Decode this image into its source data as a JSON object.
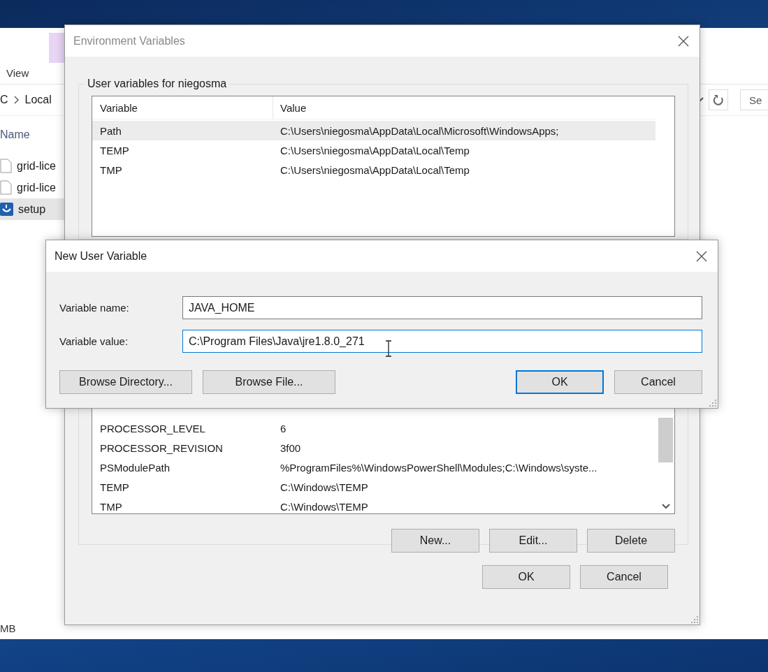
{
  "explorer": {
    "ribbon_tab": "View",
    "breadcrumb": [
      "C",
      "Local"
    ],
    "search": {
      "placeholder": "Se"
    },
    "column_header": "Name",
    "files": [
      {
        "name": "grid-lice",
        "kind": "file",
        "selected": false
      },
      {
        "name": "grid-lice",
        "kind": "file",
        "selected": false
      },
      {
        "name": "setup",
        "kind": "setup",
        "selected": true
      }
    ],
    "status_bar": "MB"
  },
  "environment_dialog": {
    "title": "Environment Variables",
    "user_group": "User variables for niegosma",
    "columns": [
      "Variable",
      "Value"
    ],
    "user_rows": [
      {
        "variable": "Path",
        "value": "C:\\Users\\niegosma\\AppData\\Local\\Microsoft\\WindowsApps;",
        "selected": true
      },
      {
        "variable": "TEMP",
        "value": "C:\\Users\\niegosma\\AppData\\Local\\Temp",
        "selected": false
      },
      {
        "variable": "TMP",
        "value": "C:\\Users\\niegosma\\AppData\\Local\\Temp",
        "selected": false
      }
    ],
    "system_rows": [
      {
        "variable": "PROCESSOR_LEVEL",
        "value": "6",
        "selected": false
      },
      {
        "variable": "PROCESSOR_REVISION",
        "value": "3f00",
        "selected": false
      },
      {
        "variable": "PSModulePath",
        "value": "%ProgramFiles%\\WindowsPowerShell\\Modules;C:\\Windows\\syste...",
        "selected": false
      },
      {
        "variable": "TEMP",
        "value": "C:\\Windows\\TEMP",
        "selected": false
      },
      {
        "variable": "TMP",
        "value": "C:\\Windows\\TEMP",
        "selected": false
      }
    ],
    "system_buttons": [
      "New...",
      "Edit...",
      "Delete"
    ],
    "buttons": [
      {
        "label": "OK",
        "default": false
      },
      {
        "label": "Cancel",
        "default": false
      }
    ]
  },
  "new_variable_dialog": {
    "title": "New User Variable",
    "fields": [
      {
        "label": "Variable name:",
        "value": "JAVA_HOME",
        "focused": false
      },
      {
        "label": "Variable value:",
        "value": "C:\\Program Files\\Java\\jre1.8.0_271",
        "focused": true
      }
    ],
    "browse_buttons": [
      "Browse Directory...",
      "Browse File..."
    ],
    "buttons": [
      {
        "label": "OK",
        "default": true
      },
      {
        "label": "Cancel",
        "default": false
      }
    ]
  }
}
